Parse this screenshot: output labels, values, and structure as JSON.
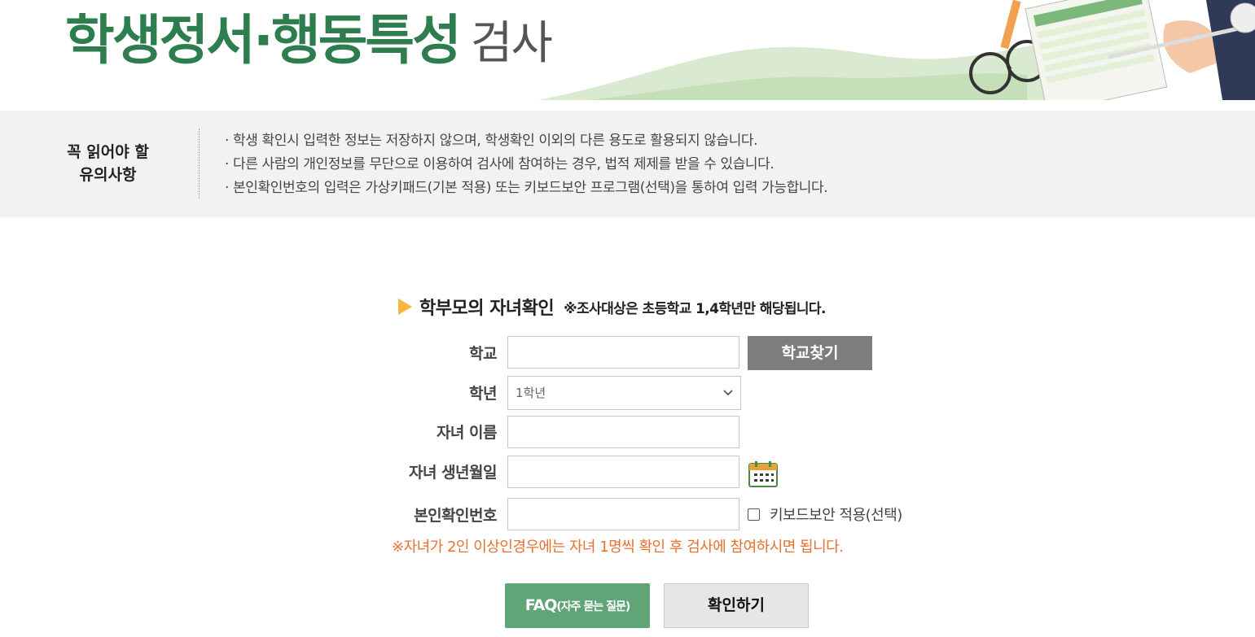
{
  "header": {
    "title_main": "학생정서·행동특성",
    "title_sub": "검사"
  },
  "notice": {
    "title_line1": "꼭 읽어야 할",
    "title_line2": "유의사항",
    "items": [
      "· 학생 확인시 입력한 정보는 저장하지 않으며, 학생확인 이외의 다른 용도로 활용되지 않습니다.",
      "· 다른 사람의 개인정보를 무단으로 이용하여 검사에 참여하는 경우, 법적 제제를 받을 수 있습니다.",
      "· 본인확인번호의 입력은 가상키패드(기본 적용) 또는 키보드보안 프로그램(선택)을 통하여 입력 가능합니다."
    ]
  },
  "form": {
    "heading": "학부모의 자녀확인",
    "heading_note": "※조사대상은 초등학교 1,4학년만 해당됩니다.",
    "school_label": "학교",
    "school_value": "",
    "find_school_button": "학교찾기",
    "grade_label": "학년",
    "grade_selected": "1학년",
    "child_name_label": "자녀 이름",
    "child_name_value": "",
    "child_birth_label": "자녀 생년월일",
    "child_birth_value": "",
    "verify_label": "본인확인번호",
    "verify_value": "",
    "keyboard_security_label": "키보드보안 적용(선택)",
    "keyboard_security_checked": false,
    "warning": "※자녀가 2인 이상인경우에는 자녀 1명씩 확인 후 검사에 참여하시면 됩니다.",
    "faq_button_main": "FAQ",
    "faq_button_sub": "(자주 묻는 질문)",
    "confirm_button": "확인하기"
  },
  "colors": {
    "title_green": "#2e7d4f",
    "faq_green": "#5fa577",
    "warning_orange": "#e8702f",
    "arrow_yellow": "#f6b73c"
  }
}
